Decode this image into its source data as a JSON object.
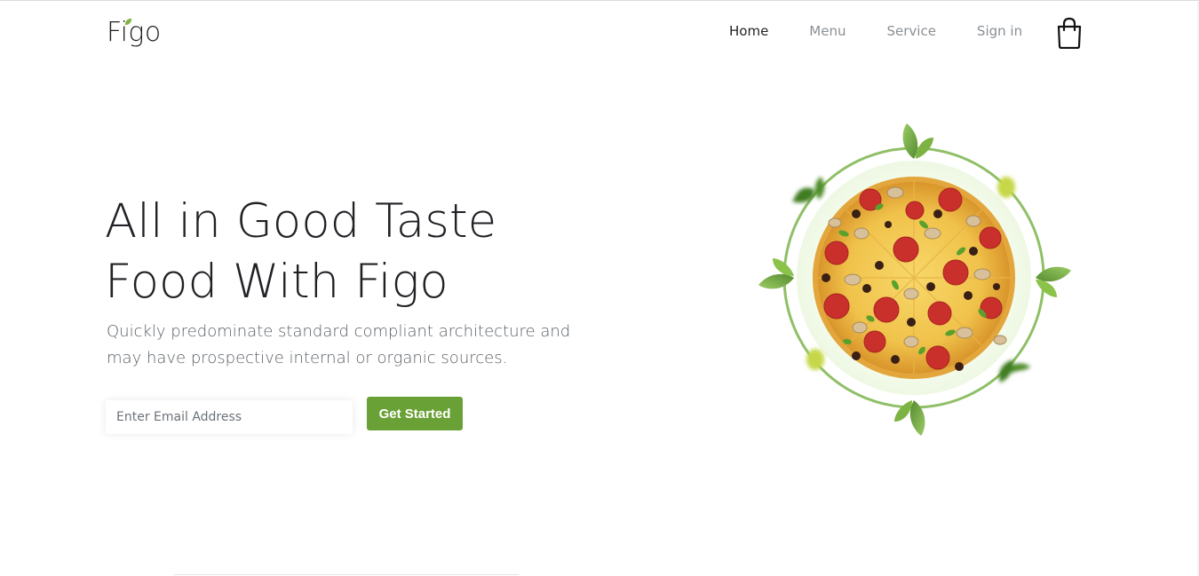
{
  "brand": {
    "logo_text": "Figo",
    "accent_color": "#6aa136",
    "leaf_color": "#7cb342"
  },
  "nav": {
    "items": [
      {
        "label": "Home",
        "active": true
      },
      {
        "label": "Menu",
        "active": false
      },
      {
        "label": "Service",
        "active": false
      },
      {
        "label": "Sign in",
        "active": false
      }
    ],
    "cart_icon": "shopping-bag-icon"
  },
  "hero": {
    "title_line1": "All in Good Taste",
    "title_line2": "Food With Figo",
    "subtitle": "Quickly predominate standard compliant architecture and may have prospective internal or organic sources.",
    "email_placeholder": "Enter Email Address",
    "cta_label": "Get Started",
    "image": "pizza-with-basil-leaves"
  }
}
